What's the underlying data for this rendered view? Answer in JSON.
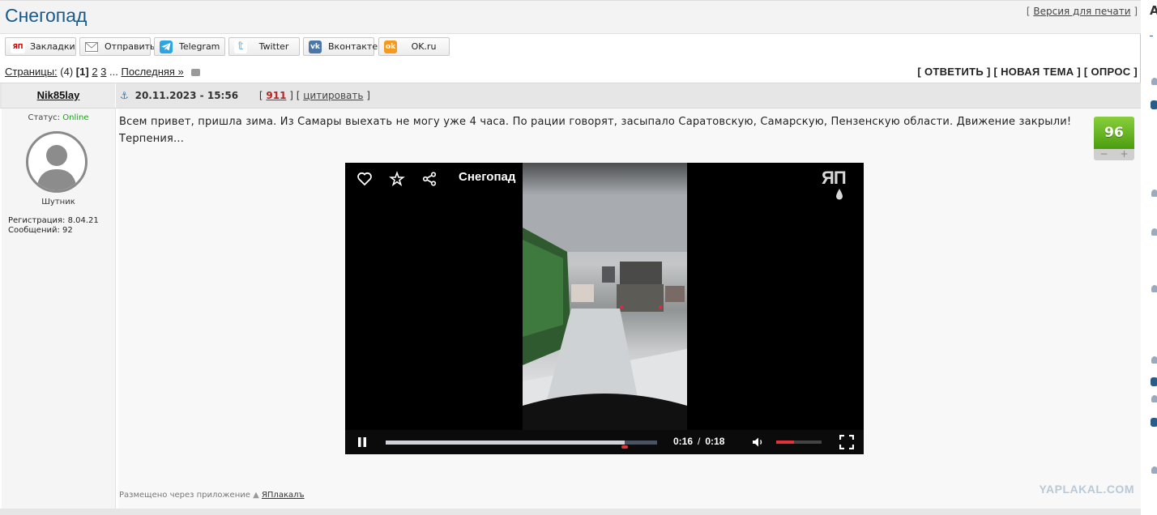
{
  "topic": {
    "title": "Снегопад",
    "print_version": "Версия для печати"
  },
  "share": [
    {
      "label": "Закладки",
      "icon": "yaplakal-icon",
      "color": "#ffffff",
      "mark": "ЯП"
    },
    {
      "label": "Отправить",
      "icon": "envelope-icon",
      "color": "#ffffff",
      "mark": ""
    },
    {
      "label": "Telegram",
      "icon": "telegram-icon",
      "color": "#2ca5e0",
      "mark": ""
    },
    {
      "label": "Twitter",
      "icon": "twitter-icon",
      "color": "#55acee",
      "mark": ""
    },
    {
      "label": "Вконтакте",
      "icon": "vk-icon",
      "color": "#4a76a8",
      "mark": "vk"
    },
    {
      "label": "OK.ru",
      "icon": "ok-icon",
      "color": "#f39a1f",
      "mark": "ok"
    }
  ],
  "pagination": {
    "label": "Страницы:",
    "count": "(4)",
    "current": "[1]",
    "pages": [
      "2",
      "3"
    ],
    "ellipsis": "...",
    "last": "Последняя »"
  },
  "actions": {
    "reply": "ОТВЕТИТЬ",
    "new_topic": "НОВАЯ ТЕМА",
    "poll": "ОПРОС"
  },
  "post": {
    "author": "Nik85lay",
    "date": "20.11.2023 - 15:56",
    "number": "911",
    "quote": "цитировать",
    "status_label": "Статус:",
    "status_value": "Online",
    "rank": "Шутник",
    "registration": "Регистрация: 8.04.21",
    "messages": "Сообщений: 92",
    "text": "Всем привет, пришла зима. Из Самары выехать не могу уже 4 часа. По рации говорят, засыпало Саратовскую, Самарскую, Пензенскую области. Движение закрыли! Терпения...",
    "rating": "96",
    "rating_minus": "−",
    "rating_plus": "+",
    "posted_via": "Размещено через приложение",
    "app_name": "ЯПлакалъ",
    "watermark": "YAPLAKAL.COM"
  },
  "video": {
    "title": "Снегопад",
    "logo": "ЯП",
    "current_time": "0:16",
    "separator": "/",
    "duration": "0:18",
    "progress": 0.88,
    "volume": 0.4,
    "accent": "#e0343a"
  },
  "sidebar": {
    "heading": "А"
  }
}
